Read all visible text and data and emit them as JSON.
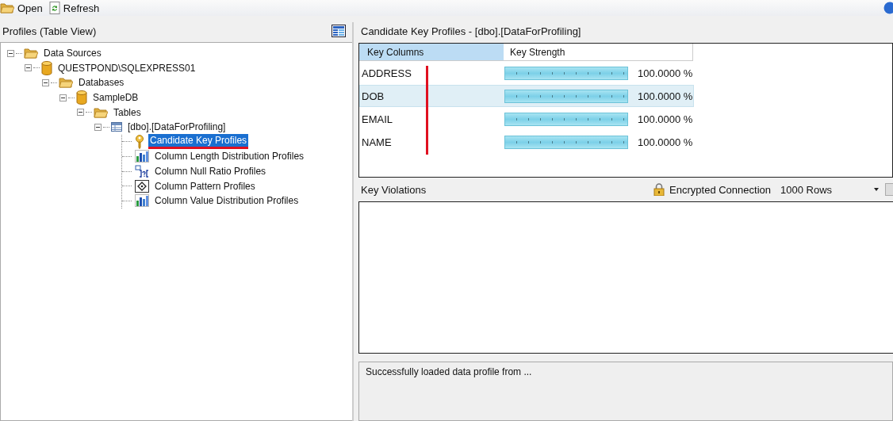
{
  "toolbar": [
    {
      "label": "Open",
      "kind": "folder"
    },
    {
      "label": "Refresh",
      "kind": "refresh"
    }
  ],
  "left_panel": {
    "title": "Profiles (Table View)"
  },
  "tree": [
    {
      "label": "Data Sources",
      "kind": "folder",
      "expanded": true,
      "selected": false,
      "children": [
        {
          "label": "QUESTPOND\\SQLEXPRESS01",
          "kind": "database",
          "expanded": true,
          "selected": false,
          "children": [
            {
              "label": "Databases",
              "kind": "folder",
              "expanded": true,
              "selected": false,
              "children": [
                {
                  "label": "SampleDB",
                  "kind": "database",
                  "expanded": true,
                  "selected": false,
                  "children": [
                    {
                      "label": "Tables",
                      "kind": "folder",
                      "expanded": true,
                      "selected": false,
                      "children": [
                        {
                          "label": "[dbo].[DataForProfiling]",
                          "kind": "table",
                          "expanded": true,
                          "selected": false,
                          "children": [
                            {
                              "label": "Candidate Key Profiles",
                              "kind": "key",
                              "selected": true,
                              "underlined": true
                            },
                            {
                              "label": "Column Length Distribution Profiles",
                              "kind": "chart",
                              "selected": false
                            },
                            {
                              "label": "Column Null Ratio Profiles",
                              "kind": "null",
                              "selected": false
                            },
                            {
                              "label": "Column Pattern Profiles",
                              "kind": "pattern",
                              "selected": false
                            },
                            {
                              "label": "Column Value Distribution Profiles",
                              "kind": "chart",
                              "selected": false
                            }
                          ]
                        }
                      ]
                    }
                  ]
                }
              ]
            }
          ]
        }
      ]
    }
  ],
  "profile_panel": {
    "title": "Candidate Key Profiles  -  [dbo].[DataForProfiling]",
    "columns": [
      {
        "label": "Key Columns",
        "selected": true
      },
      {
        "label": "Key Strength",
        "selected": false
      }
    ],
    "rows": [
      {
        "name": "ADDRESS",
        "level": 1,
        "reading": "100.0000 %",
        "selected": false
      },
      {
        "name": "DOB",
        "level": 1,
        "reading": "100.0000 %",
        "selected": true
      },
      {
        "name": "EMAIL",
        "level": 1,
        "reading": "100.0000 %",
        "selected": false
      },
      {
        "name": "NAME",
        "level": 1,
        "reading": "100.0000 %",
        "selected": false
      }
    ]
  },
  "violations_panel": {
    "title": "Key Violations",
    "connection": "Encrypted Connection",
    "rows_dropdown": "1000 Rows"
  },
  "status": {
    "message": "Successfully loaded data profile from  ..."
  }
}
